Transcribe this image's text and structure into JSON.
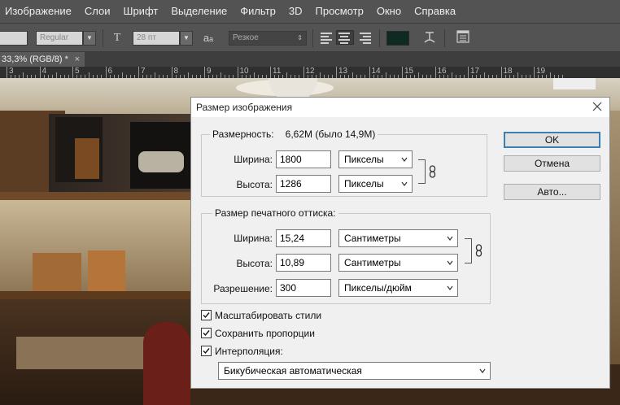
{
  "menu": [
    "Изображение",
    "Слои",
    "Шрифт",
    "Выделение",
    "Фильтр",
    "3D",
    "Просмотр",
    "Окно",
    "Справка"
  ],
  "options_bar": {
    "font_style": "Regular",
    "font_size": "28 пт",
    "aa_label": "a",
    "aa_sub": "a",
    "antialias": "Резкое",
    "text_color": "#0f2a22"
  },
  "document_tab": {
    "title": "33,3% (RGB/8) *",
    "close": "×"
  },
  "ruler": {
    "labels": [
      "3",
      "4",
      "5",
      "6",
      "7",
      "8",
      "9",
      "10",
      "11",
      "12",
      "13",
      "14",
      "15",
      "16",
      "17",
      "18",
      "19"
    ]
  },
  "dialog": {
    "title": "Размер изображения",
    "dimensions": {
      "label": "Размерность:",
      "value": "6,62M (было 14,9M)",
      "width_label": "Ширина:",
      "width_value": "1800",
      "width_unit": "Пикселы",
      "height_label": "Высота:",
      "height_value": "1286",
      "height_unit": "Пикселы"
    },
    "print_size": {
      "label": "Размер печатного оттиска:",
      "width_label": "Ширина:",
      "width_value": "15,24",
      "width_unit": "Сантиметры",
      "height_label": "Высота:",
      "height_value": "10,89",
      "height_unit": "Сантиметры",
      "resolution_label": "Разрешение:",
      "resolution_value": "300",
      "resolution_unit": "Пикселы/дюйм"
    },
    "options": {
      "scale_styles": "Масштабировать стили",
      "constrain": "Сохранить пропорции",
      "resample": "Интерполяция:",
      "method": "Бикубическая автоматическая"
    },
    "buttons": {
      "ok": "OK",
      "cancel": "Отмена",
      "auto": "Авто..."
    }
  }
}
